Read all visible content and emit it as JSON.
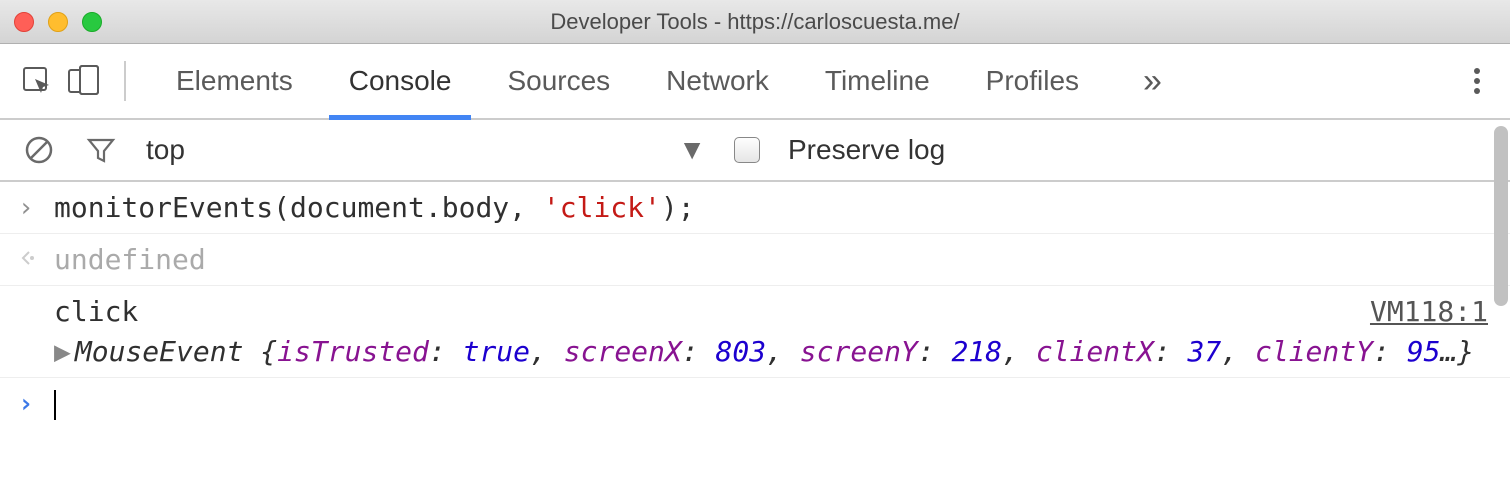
{
  "window": {
    "title": "Developer Tools - https://carloscuesta.me/"
  },
  "tabs": {
    "items": [
      "Elements",
      "Console",
      "Sources",
      "Network",
      "Timeline",
      "Profiles"
    ],
    "active": "Console",
    "overflow": "»"
  },
  "subbar": {
    "context": "top",
    "preserve_label": "Preserve log",
    "preserve_checked": false
  },
  "console": {
    "input_line": {
      "func": "monitorEvents",
      "args_plain": "(document.body, ",
      "args_string": "'click'",
      "tail": ");"
    },
    "output_line": "undefined",
    "log": {
      "event_name": "click",
      "source": "VM118:1",
      "class": "MouseEvent",
      "open": "{",
      "close": "…}",
      "props": [
        {
          "k": "isTrusted",
          "v": "true"
        },
        {
          "k": "screenX",
          "v": "803"
        },
        {
          "k": "screenY",
          "v": "218"
        },
        {
          "k": "clientX",
          "v": "37"
        },
        {
          "k": "clientY",
          "v": "95"
        }
      ]
    }
  }
}
